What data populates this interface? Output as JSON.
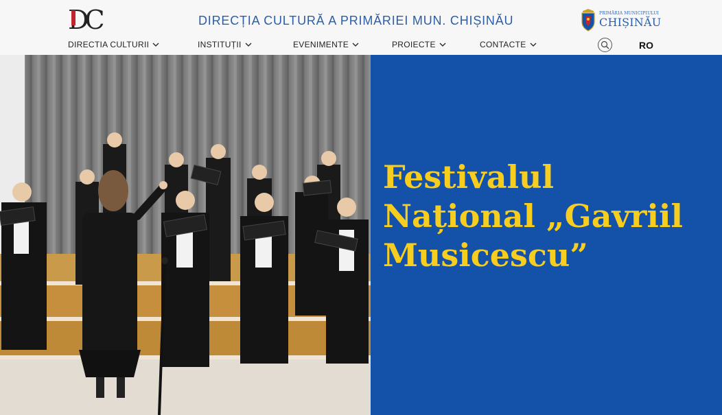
{
  "header": {
    "logo_text": "DC",
    "site_title": "DIRECȚIA CULTURĂ A PRIMĂRIEI MUN. CHIȘINĂU",
    "city_logo_sub": "PRIMĂRIA MUNICIPIULUI",
    "city_logo_name": "CHIȘINĂU"
  },
  "nav": {
    "items": [
      {
        "label": "DIRECTIA CULTURII",
        "icon": "chevron-down-icon"
      },
      {
        "label": "INSTITUȚII",
        "icon": "chevron-down-icon"
      },
      {
        "label": "EVENIMENTE",
        "icon": "chevron-down-icon"
      },
      {
        "label": "PROIECTE",
        "icon": "chevron-down-icon"
      },
      {
        "label": "CONTACTE",
        "icon": "chevron-down-icon"
      }
    ],
    "search_icon": "search-icon",
    "language": "RO"
  },
  "hero": {
    "image_subject": "choir performing on stage with conductor",
    "title": "Festivalul Național „Gavriil Musicescu”"
  },
  "colors": {
    "accent": "#2a5ea9",
    "panel": "#1451a9",
    "title_text": "#f7cd1f"
  }
}
